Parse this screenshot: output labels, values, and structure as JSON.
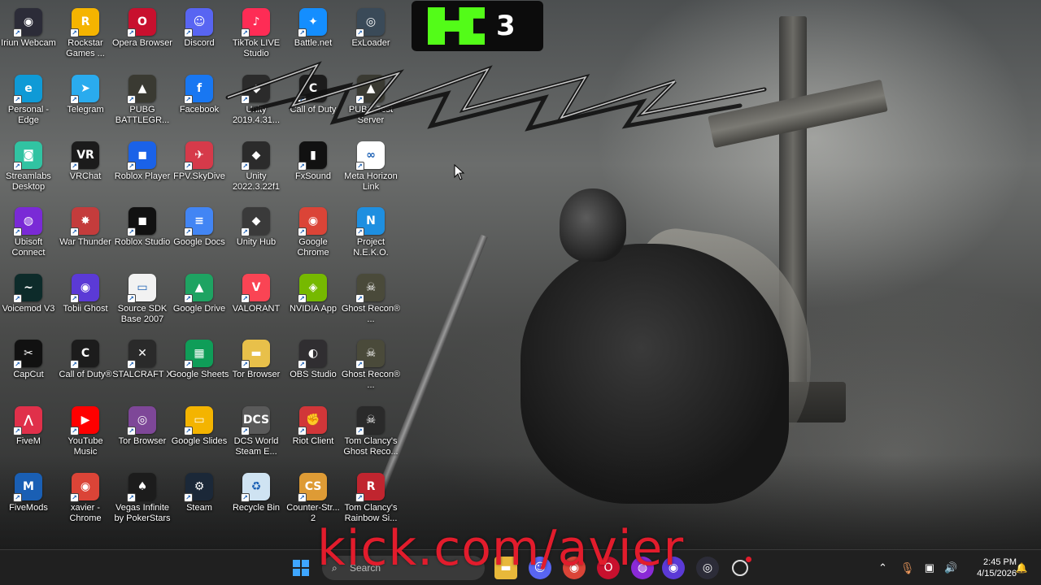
{
  "desktop": {
    "icons": [
      {
        "label": "Iriun Webcam",
        "glyph": "◉",
        "color": "#2c2c38",
        "icon": "iriun-icon"
      },
      {
        "label": "Rockstar Games ...",
        "glyph": "R",
        "color": "#f5b400",
        "icon": "rockstar-icon"
      },
      {
        "label": "Opera Browser",
        "glyph": "O",
        "color": "#c8102e",
        "icon": "opera-icon"
      },
      {
        "label": "Discord",
        "glyph": "☺",
        "color": "#5865f2",
        "icon": "discord-icon"
      },
      {
        "label": "TikTok LIVE Studio",
        "glyph": "♪",
        "color": "#fe2c55",
        "icon": "tiktok-icon"
      },
      {
        "label": "Battle.net",
        "glyph": "✦",
        "color": "#148eff",
        "icon": "battlenet-icon"
      },
      {
        "label": "ExLoader",
        "glyph": "◎",
        "color": "#3a4a58",
        "icon": "exloader-icon"
      },
      {
        "label": "Personal - Edge",
        "glyph": "e",
        "color": "#0f9ad6",
        "icon": "edge-icon"
      },
      {
        "label": "Telegram",
        "glyph": "➤",
        "color": "#2aabee",
        "icon": "telegram-icon"
      },
      {
        "label": "PUBG BATTLEGR...",
        "glyph": "▲",
        "color": "#3a3a32",
        "icon": "pubg-icon"
      },
      {
        "label": "Facebook",
        "glyph": "f",
        "color": "#1877f2",
        "icon": "facebook-icon"
      },
      {
        "label": "Unity 2019.4.31...",
        "glyph": "◆",
        "color": "#2b2b2b",
        "icon": "unity-icon"
      },
      {
        "label": "Call of Duty",
        "glyph": "C",
        "color": "#1c1c1c",
        "icon": "cod-icon"
      },
      {
        "label": "PUBG Test Server",
        "glyph": "▲",
        "color": "#3a3a32",
        "icon": "pubg-test-icon"
      },
      {
        "label": "Streamlabs Desktop",
        "glyph": "◙",
        "color": "#31c3a2",
        "icon": "streamlabs-icon"
      },
      {
        "label": "VRChat",
        "glyph": "VR",
        "color": "#1b1b1b",
        "icon": "vrchat-icon"
      },
      {
        "label": "Roblox Player",
        "glyph": "◼",
        "color": "#1a62e8",
        "icon": "roblox-player-icon"
      },
      {
        "label": "FPV.SkyDive",
        "glyph": "✈",
        "color": "#d63a4a",
        "icon": "fpv-skydive-icon"
      },
      {
        "label": "Unity 2022.3.22f1",
        "glyph": "◆",
        "color": "#2b2b2b",
        "icon": "unity-icon"
      },
      {
        "label": "FxSound",
        "glyph": "▮",
        "color": "#111111",
        "icon": "fxsound-icon"
      },
      {
        "label": "Meta Horizon Link",
        "glyph": "∞",
        "color": "#ffffff",
        "icon": "meta-icon"
      },
      {
        "label": "Ubisoft Connect",
        "glyph": "◍",
        "color": "#7a2ad6",
        "icon": "ubisoft-icon"
      },
      {
        "label": "War Thunder",
        "glyph": "✸",
        "color": "#c43c3c",
        "icon": "warthunder-icon"
      },
      {
        "label": "Roblox Studio",
        "glyph": "◼",
        "color": "#111111",
        "icon": "roblox-studio-icon"
      },
      {
        "label": "Google Docs",
        "glyph": "≡",
        "color": "#4285f4",
        "icon": "google-docs-icon"
      },
      {
        "label": "Unity Hub",
        "glyph": "◆",
        "color": "#3a3a3a",
        "icon": "unity-hub-icon"
      },
      {
        "label": "Google Chrome",
        "glyph": "◉",
        "color": "#db4437",
        "icon": "chrome-icon"
      },
      {
        "label": "Project N.E.K.O.",
        "glyph": "N",
        "color": "#1e8fe0",
        "icon": "neko-icon"
      },
      {
        "label": "Voicemod V3",
        "glyph": "~",
        "color": "#0d2b2a",
        "icon": "voicemod-icon"
      },
      {
        "label": "Tobii Ghost",
        "glyph": "◉",
        "color": "#5b3ad6",
        "icon": "tobii-icon"
      },
      {
        "label": "Source SDK Base 2007",
        "glyph": "▭",
        "color": "#f2f2f2",
        "icon": "source-sdk-icon"
      },
      {
        "label": "Google Drive",
        "glyph": "▲",
        "color": "#1ea362",
        "icon": "google-drive-icon"
      },
      {
        "label": "VALORANT",
        "glyph": "V",
        "color": "#fa4454",
        "icon": "valorant-icon"
      },
      {
        "label": "NVIDIA App",
        "glyph": "◈",
        "color": "#76b900",
        "icon": "nvidia-icon"
      },
      {
        "label": "Ghost Recon® ...",
        "glyph": "☠",
        "color": "#4a4a3a",
        "icon": "ghost-recon-icon"
      },
      {
        "label": "CapCut",
        "glyph": "✂",
        "color": "#111111",
        "icon": "capcut-icon"
      },
      {
        "label": "Call of Duty®",
        "glyph": "C",
        "color": "#1c1c1c",
        "icon": "cod-icon"
      },
      {
        "label": "STALCRAFT X",
        "glyph": "✕",
        "color": "#2a2a2a",
        "icon": "stalcraft-icon"
      },
      {
        "label": "Google Sheets",
        "glyph": "▦",
        "color": "#0f9d58",
        "icon": "google-sheets-icon"
      },
      {
        "label": "Tor Browser",
        "glyph": "▬",
        "color": "#e8c04a",
        "icon": "folder-icon"
      },
      {
        "label": "OBS Studio",
        "glyph": "◐",
        "color": "#302e31",
        "icon": "obs-icon"
      },
      {
        "label": "Ghost Recon® ...",
        "glyph": "☠",
        "color": "#4a4a3a",
        "icon": "ghost-recon-icon"
      },
      {
        "label": "FiveM",
        "glyph": "⋀",
        "color": "#e0304a",
        "icon": "fivem-icon"
      },
      {
        "label": "YouTube Music",
        "glyph": "▶",
        "color": "#ff0000",
        "icon": "youtube-music-icon"
      },
      {
        "label": "Tor Browser",
        "glyph": "◎",
        "color": "#7e4798",
        "icon": "tor-icon"
      },
      {
        "label": "Google Slides",
        "glyph": "▭",
        "color": "#f4b400",
        "icon": "google-slides-icon"
      },
      {
        "label": "DCS World Steam E...",
        "glyph": "DCS",
        "color": "#5a5a5a",
        "icon": "dcs-icon"
      },
      {
        "label": "Riot Client",
        "glyph": "✊",
        "color": "#d13639",
        "icon": "riot-icon"
      },
      {
        "label": "Tom Clancy's Ghost Reco...",
        "glyph": "☠",
        "color": "#2a2a2a",
        "icon": "ghost-recon-icon"
      },
      {
        "label": "FiveMods",
        "glyph": "M",
        "color": "#1a5fb4",
        "icon": "fivemods-icon"
      },
      {
        "label": "xavier - Chrome",
        "glyph": "◉",
        "color": "#db4437",
        "icon": "chrome-icon"
      },
      {
        "label": "Vegas Infinite by PokerStars",
        "glyph": "♠",
        "color": "#1c1c1c",
        "icon": "vegas-icon"
      },
      {
        "label": "Steam",
        "glyph": "⚙",
        "color": "#1b2838",
        "icon": "steam-icon"
      },
      {
        "label": "Recycle Bin",
        "glyph": "♻",
        "color": "#cfe3f2",
        "icon": "recycle-bin-icon"
      },
      {
        "label": "Counter-Str... 2",
        "glyph": "CS",
        "color": "#de9b35",
        "icon": "cs2-icon"
      },
      {
        "label": "Tom Clancy's Rainbow Si...",
        "glyph": "R",
        "color": "#c0252f",
        "icon": "rainbow-six-icon"
      }
    ]
  },
  "overlay": {
    "badge_number": "3",
    "kick_url": "kick.com/avier"
  },
  "taskbar": {
    "search_placeholder": "Search",
    "time": "2:45 PM",
    "date": "4/15/2026"
  }
}
